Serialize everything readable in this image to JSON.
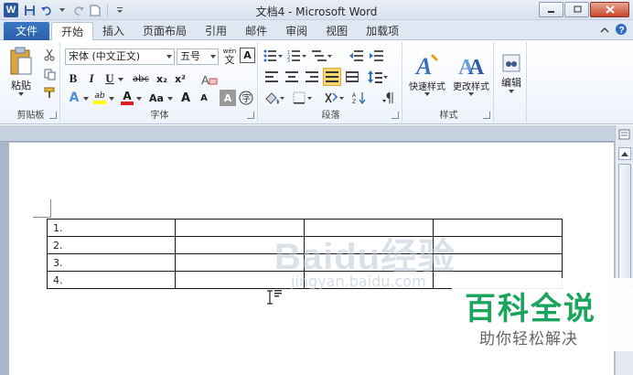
{
  "window": {
    "title": "文档4 - Microsoft Word",
    "app_icon": "W"
  },
  "quick_access": [
    "save-icon",
    "undo-icon",
    "redo-icon",
    "new-icon",
    "customize-icon"
  ],
  "tabs": {
    "file": "文件",
    "items": [
      "开始",
      "插入",
      "页面布局",
      "引用",
      "邮件",
      "审阅",
      "视图",
      "加载项"
    ],
    "active": "开始"
  },
  "ribbon": {
    "clipboard": {
      "label": "剪贴板",
      "paste": "粘贴"
    },
    "font": {
      "label": "字体",
      "font_name": "宋体 (中文正文)",
      "font_size": "五号",
      "phonetic": "wén",
      "bold": "B",
      "italic": "I",
      "underline": "U",
      "strikethrough": "abc",
      "subscript": "x₂",
      "superscript": "x²",
      "highlight": "ab",
      "font_color": "A",
      "change_case": "Aa",
      "grow": "A",
      "shrink": "A",
      "clear": "A",
      "char_border": "A",
      "text_effect": "A"
    },
    "paragraph": {
      "label": "段落"
    },
    "styles": {
      "label": "样式",
      "quick_styles": "快速样式",
      "change_styles": "更改样式"
    },
    "editing": {
      "label": "编辑"
    }
  },
  "document": {
    "table_rows": [
      [
        "1.",
        "",
        "",
        ""
      ],
      [
        "2.",
        "",
        "",
        ""
      ],
      [
        "3.",
        "",
        "",
        ""
      ],
      [
        "4.",
        "",
        "",
        ""
      ]
    ]
  },
  "watermark": {
    "logo": "Baidu经验",
    "url": "jingyan.baidu.com",
    "badge_title": "百科全说",
    "badge_subtitle": "助你轻松解决"
  }
}
